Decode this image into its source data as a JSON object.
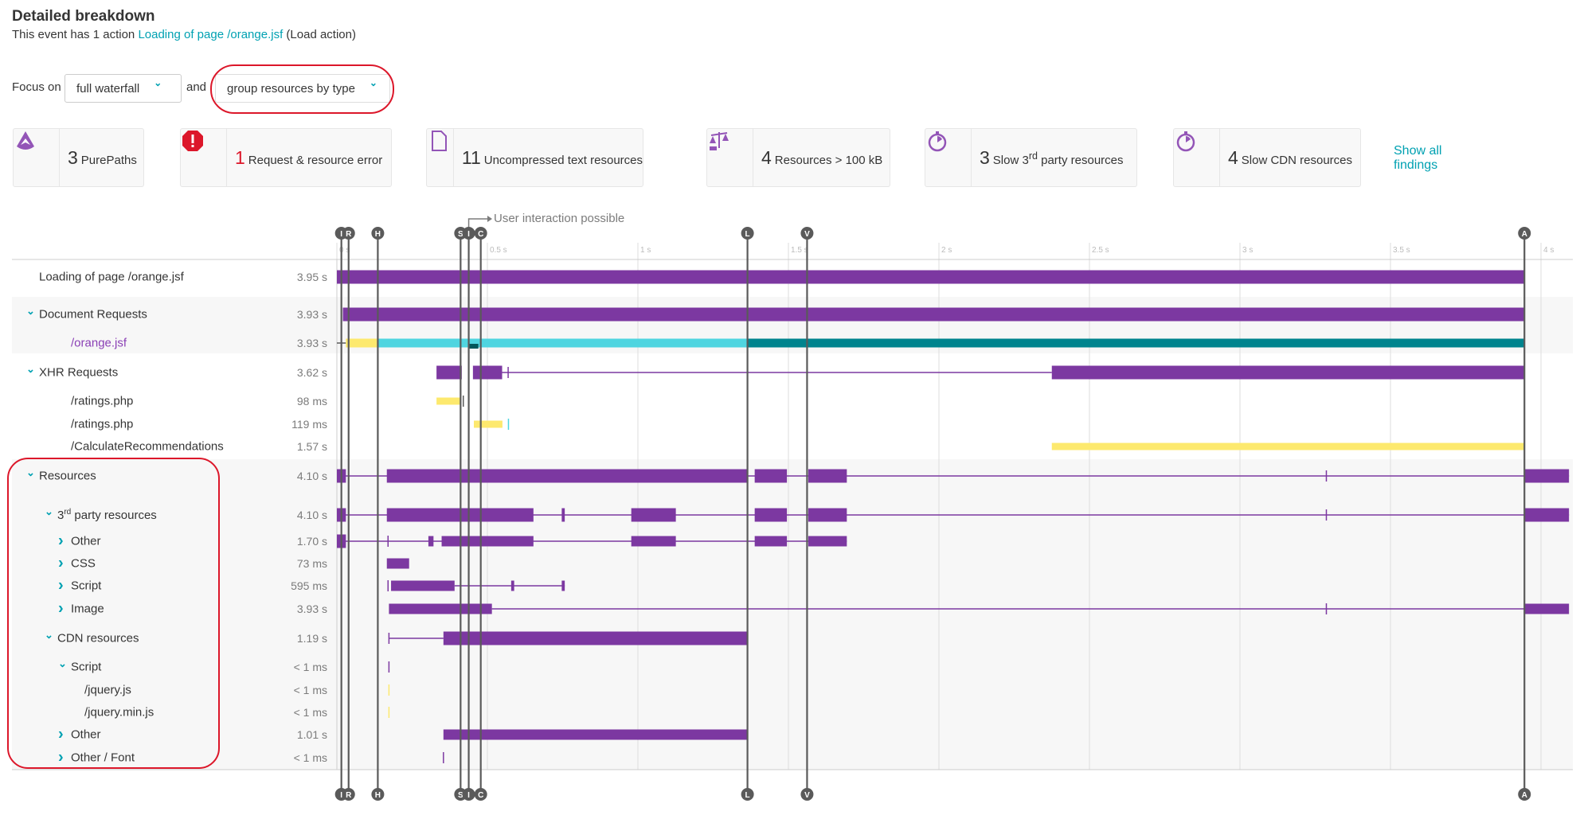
{
  "header": {
    "title": "Detailed breakdown",
    "subtitle_prefix": "This event has 1 action ",
    "subtitle_link": "Loading of page /orange.jsf",
    "subtitle_suffix": " (Load action)"
  },
  "focus": {
    "label": "Focus on",
    "dropdown1": "full waterfall",
    "and": "and",
    "dropdown2": "group resources by type"
  },
  "findings": [
    {
      "num": "3",
      "label": "PurePaths",
      "icon": "purepath-icon",
      "num_color": "#353535"
    },
    {
      "num": "1",
      "label": "Request & resource error",
      "icon": "error-icon",
      "num_color": "#dc172a"
    },
    {
      "num": "11",
      "label": "Uncompressed text resources",
      "icon": "document-icon",
      "num_color": "#353535"
    },
    {
      "num": "4",
      "label": "Resources > 100 kB",
      "icon": "scale-icon",
      "num_color": "#353535"
    },
    {
      "num": "3",
      "label": "Slow 3rd party resources",
      "icon": "stopwatch-icon",
      "num_color": "#353535"
    },
    {
      "num": "4",
      "label": "Slow CDN resources",
      "icon": "stopwatch-icon",
      "num_color": "#353535"
    }
  ],
  "show_all": "Show all findings",
  "annotation": "User interaction possible",
  "colors": {
    "purple": "#7c38a1",
    "yellow": "#fde96e",
    "cyan": "#4fd5e0",
    "teal": "#00848e",
    "dark": "#00585c",
    "marker": "#5a5a5a",
    "accent": "#00a1b2",
    "highlight": "#dc172a"
  },
  "chart_data": {
    "type": "waterfall",
    "x_unit": "s",
    "xlim": [
      0,
      4.1
    ],
    "ticks": [
      {
        "v": 0,
        "label": "0 s"
      },
      {
        "v": 0.5,
        "label": "0.5 s"
      },
      {
        "v": 1,
        "label": "1 s"
      },
      {
        "v": 1.5,
        "label": "1.5 s"
      },
      {
        "v": 2,
        "label": "2 s"
      },
      {
        "v": 2.5,
        "label": "2.5 s"
      },
      {
        "v": 3,
        "label": "3 s"
      },
      {
        "v": 3.5,
        "label": "3.5 s"
      },
      {
        "v": 4,
        "label": "4 s"
      }
    ],
    "markers": [
      {
        "label": "I",
        "t": 0.015
      },
      {
        "label": "R",
        "t": 0.039
      },
      {
        "label": "H",
        "t": 0.136
      },
      {
        "label": "S",
        "t": 0.411
      },
      {
        "label": "I",
        "t": 0.438
      },
      {
        "label": "C",
        "t": 0.478
      },
      {
        "label": "L",
        "t": 1.364
      },
      {
        "label": "V",
        "t": 1.562
      },
      {
        "label": "A",
        "t": 3.945
      }
    ],
    "rows": [
      {
        "label": "Loading of page /orange.jsf",
        "value": "3.95 s",
        "level": 0,
        "chev": "",
        "segs": [
          [
            "bar",
            0,
            3.945,
            "purple"
          ]
        ]
      },
      {
        "label": "Document Requests",
        "value": "3.93 s",
        "level": 0,
        "chev": "down",
        "segs": [
          [
            "bar",
            0.02,
            3.945,
            "purple"
          ]
        ]
      },
      {
        "label": "/orange.jsf",
        "value": "3.93 s",
        "level": 2,
        "chev": "",
        "link": true,
        "segs": [
          [
            "line",
            0.0,
            0.03,
            "marker"
          ],
          [
            "mid",
            0.03,
            0.136,
            "yellow"
          ],
          [
            "mid",
            0.136,
            1.364,
            "cyan"
          ],
          [
            "mid",
            1.364,
            3.945,
            "teal"
          ],
          [
            "dark",
            0.438,
            0.47,
            "dark"
          ]
        ]
      },
      {
        "label": "XHR Requests",
        "value": "3.62 s",
        "level": 0,
        "chev": "down",
        "segs": [
          [
            "line",
            0.549,
            2.375,
            "purple"
          ],
          [
            "bar",
            0.331,
            0.415,
            "purple"
          ],
          [
            "bar",
            0.452,
            0.549,
            "purple"
          ],
          [
            "tick",
            0.569,
            0.569,
            "purple"
          ],
          [
            "bar",
            2.375,
            3.945,
            "purple"
          ]
        ]
      },
      {
        "label": "/ratings.php",
        "value": "98 ms",
        "level": 2,
        "chev": "",
        "segs": [
          [
            "thin",
            0.331,
            0.41,
            "yellow"
          ],
          [
            "tick",
            0.42,
            0.42,
            "marker"
          ]
        ]
      },
      {
        "label": "/ratings.php",
        "value": "119 ms",
        "level": 2,
        "chev": "",
        "segs": [
          [
            "thin",
            0.455,
            0.55,
            "yellow"
          ],
          [
            "tick",
            0.57,
            0.57,
            "cyan"
          ]
        ]
      },
      {
        "label": "/CalculateRecommendations",
        "value": "1.57 s",
        "level": 2,
        "chev": "",
        "segs": [
          [
            "thin",
            2.375,
            3.945,
            "yellow"
          ]
        ]
      },
      {
        "label": "Resources",
        "value": "4.10 s",
        "level": 0,
        "chev": "down",
        "segs": [
          [
            "line",
            0,
            4.093,
            "purple"
          ],
          [
            "bar",
            0,
            0.03,
            "purple"
          ],
          [
            "bar",
            0.166,
            1.364,
            "purple"
          ],
          [
            "bar",
            1.388,
            1.495,
            "purple"
          ],
          [
            "bar",
            1.566,
            1.694,
            "purple"
          ],
          [
            "tick",
            3.287,
            3.287,
            "purple"
          ],
          [
            "bar",
            3.945,
            4.093,
            "purple"
          ]
        ]
      },
      {
        "label": "3rd party resources",
        "sup": "rd",
        "value": "4.10 s",
        "level": 1,
        "chev": "down",
        "segs": [
          [
            "line",
            0,
            4.093,
            "purple"
          ],
          [
            "bar",
            0,
            0.03,
            "purple"
          ],
          [
            "bar",
            0.166,
            0.653,
            "purple"
          ],
          [
            "bar",
            0.747,
            0.757,
            "purple"
          ],
          [
            "bar",
            0.978,
            1.126,
            "purple"
          ],
          [
            "bar",
            1.388,
            1.495,
            "purple"
          ],
          [
            "bar",
            1.566,
            1.694,
            "purple"
          ],
          [
            "tick",
            3.287,
            3.287,
            "purple"
          ],
          [
            "bar",
            3.945,
            4.093,
            "purple"
          ]
        ]
      },
      {
        "label": "Other",
        "value": "1.70 s",
        "level": 2,
        "chev": "right",
        "segs": [
          [
            "line",
            0,
            1.694,
            "purple"
          ],
          [
            "bar",
            0,
            0.03,
            "purple"
          ],
          [
            "tick",
            0.17,
            0.17,
            "purple"
          ],
          [
            "small",
            0.304,
            0.321,
            "purple"
          ],
          [
            "small",
            0.348,
            0.653,
            "purple"
          ],
          [
            "small",
            0.978,
            1.126,
            "purple"
          ],
          [
            "small",
            1.388,
            1.495,
            "purple"
          ],
          [
            "small",
            1.566,
            1.694,
            "purple"
          ]
        ]
      },
      {
        "label": "CSS",
        "value": "73 ms",
        "level": 2,
        "chev": "right",
        "segs": [
          [
            "small",
            0.166,
            0.24,
            "purple"
          ]
        ]
      },
      {
        "label": "Script",
        "value": "595 ms",
        "level": 2,
        "chev": "right",
        "segs": [
          [
            "line",
            0.391,
            0.757,
            "purple"
          ],
          [
            "tick",
            0.17,
            0.17,
            "purple"
          ],
          [
            "small",
            0.18,
            0.391,
            "purple"
          ],
          [
            "small",
            0.579,
            0.589,
            "purple"
          ],
          [
            "small",
            0.747,
            0.757,
            "purple"
          ]
        ]
      },
      {
        "label": "Image",
        "value": "3.93 s",
        "level": 2,
        "chev": "right",
        "segs": [
          [
            "line",
            0.515,
            3.945,
            "purple"
          ],
          [
            "small",
            0.173,
            0.515,
            "purple"
          ],
          [
            "tick",
            3.287,
            3.287,
            "purple"
          ],
          [
            "small",
            3.945,
            4.093,
            "purple"
          ]
        ]
      },
      {
        "label": "CDN resources",
        "value": "1.19 s",
        "level": 1,
        "chev": "down",
        "segs": [
          [
            "line",
            0.173,
            0.354,
            "purple"
          ],
          [
            "tick",
            0.173,
            0.173,
            "purple"
          ],
          [
            "bar",
            0.354,
            1.364,
            "purple"
          ]
        ]
      },
      {
        "label": "Script",
        "value": "< 1 ms",
        "level": 2,
        "chev": "down",
        "segs": [
          [
            "tick",
            0.173,
            0.173,
            "purple"
          ]
        ]
      },
      {
        "label": "/jquery.js",
        "value": "< 1 ms",
        "level": 3,
        "chev": "",
        "segs": [
          [
            "tick",
            0.173,
            0.173,
            "yellow"
          ]
        ]
      },
      {
        "label": "/jquery.min.js",
        "value": "< 1 ms",
        "level": 3,
        "chev": "",
        "segs": [
          [
            "tick",
            0.173,
            0.173,
            "yellow"
          ]
        ]
      },
      {
        "label": "Other",
        "value": "1.01 s",
        "level": 2,
        "chev": "right",
        "segs": [
          [
            "small",
            0.354,
            1.364,
            "purple"
          ]
        ]
      },
      {
        "label": "Other / Font",
        "value": "< 1 ms",
        "level": 2,
        "chev": "right",
        "segs": [
          [
            "tick",
            0.354,
            0.354,
            "purple"
          ]
        ]
      }
    ]
  }
}
